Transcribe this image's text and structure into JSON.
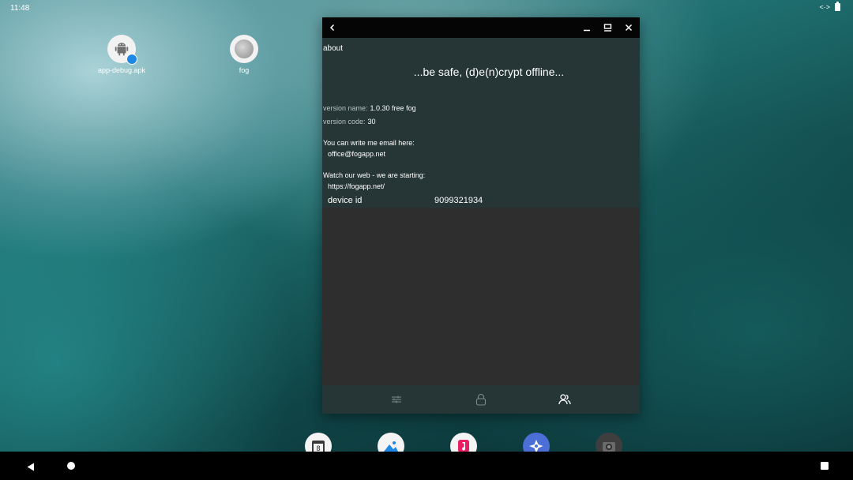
{
  "status_bar": {
    "time": "11:48",
    "sync_indicator": "<·>"
  },
  "desktop": {
    "icons": [
      {
        "label": "app-debug.apk",
        "icon": "android-icon"
      },
      {
        "label": "fog",
        "icon": "fog-app-icon"
      }
    ]
  },
  "window": {
    "titlebar": {
      "back_icon": "back-arrow-icon",
      "minimize_icon": "minimize-icon",
      "maximize_icon": "maximize-icon",
      "close_icon": "close-icon"
    },
    "about": {
      "title": "about",
      "tagline": "...be safe, (d)e(n)crypt offline...",
      "version_name_label": "version name:",
      "version_name_value": "1.0.30 free fog",
      "version_code_label": "version code:",
      "version_code_value": "30",
      "email_prompt": "You can write me email here:",
      "email": "office@fogapp.net",
      "web_prompt": "Watch our web - we are starting:",
      "web_url": "https://fogapp.net/",
      "device_id_label": "device id",
      "device_id_value": "9099321934"
    },
    "bottom_nav": [
      {
        "icon": "settings-sliders-icon",
        "active": false
      },
      {
        "icon": "lock-icon",
        "active": false
      },
      {
        "icon": "people-icon",
        "active": true
      }
    ]
  },
  "dock": [
    {
      "icon": "calendar-icon"
    },
    {
      "icon": "gallery-icon"
    },
    {
      "icon": "music-icon"
    },
    {
      "icon": "discover-icon"
    },
    {
      "icon": "camera-icon"
    }
  ],
  "colors": {
    "window_content_bg": "#263636",
    "window_body_bg": "#2e2e2e",
    "titlebar_bg": "#050505",
    "nav_bar_bg": "#000000"
  }
}
